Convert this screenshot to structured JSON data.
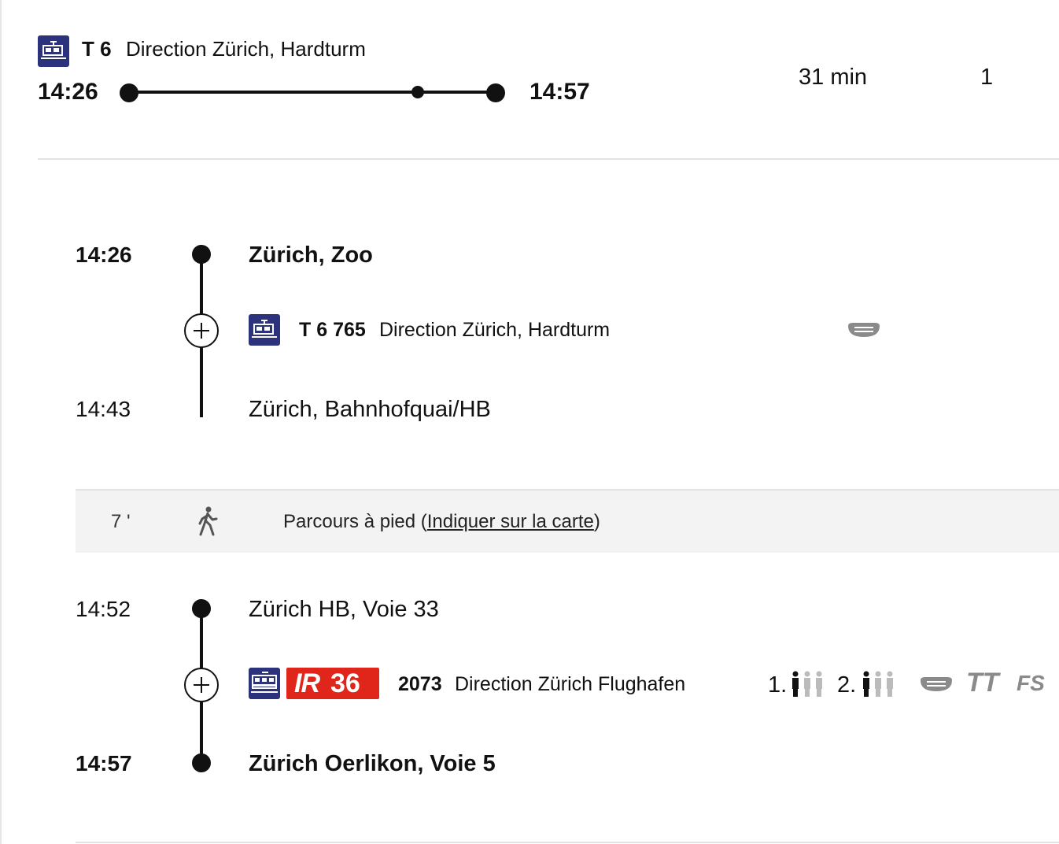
{
  "summary": {
    "line_label": "T 6",
    "direction": "Direction Zürich, Hardturm",
    "departure": "14:26",
    "arrival": "14:57",
    "duration": "31 min",
    "changes": "1"
  },
  "legs": [
    {
      "from_time": "14:26",
      "from_stop": "Zürich, Zoo",
      "line": "T 6 765",
      "direction": "Direction Zürich, Hardturm",
      "to_time": "14:43",
      "to_stop": "Zürich, Bahnhofquai/HB",
      "icons": [
        "tram-icon",
        "mask-icon"
      ]
    },
    {
      "from_time": "14:52",
      "from_stop": "Zürich HB, Voie 33",
      "product": "IR",
      "product_number": "36",
      "line": "2073",
      "direction": "Direction Zürich Flughafen",
      "to_time": "14:57",
      "to_stop": "Zürich Oerlikon, Voie 5",
      "occupancy": [
        {
          "class_label": "1.",
          "level": 1
        },
        {
          "class_label": "2.",
          "level": 1
        }
      ],
      "attributes": [
        "TT",
        "FS"
      ],
      "icons": [
        "train-icon",
        "mask-icon"
      ]
    }
  ],
  "walk": {
    "duration": "7 '",
    "text": "Parcours à pied",
    "paren_open": "(",
    "link": "Indiquer sur la carte",
    "paren_close": ")"
  },
  "colors": {
    "tram_bg": "#2d327d",
    "ir_red": "#e0261b",
    "muted_icon": "#8a8a8a"
  }
}
